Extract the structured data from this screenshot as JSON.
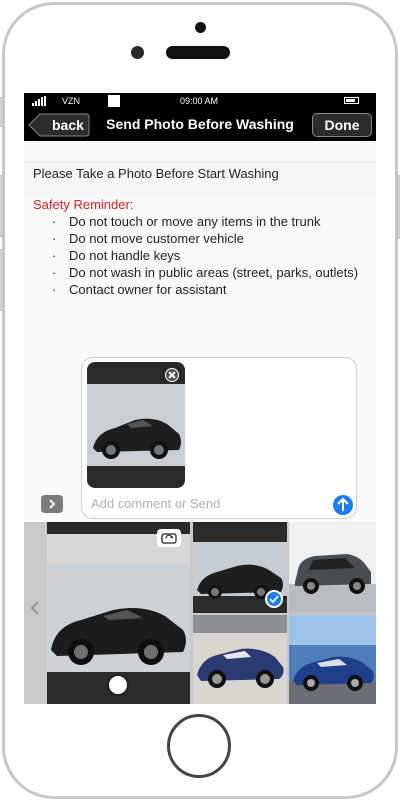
{
  "status_bar": {
    "carrier": "VZN",
    "time": "09:00 AM"
  },
  "nav": {
    "back_label": "back",
    "title": "Send Photo Before Washing",
    "done_label": "Done"
  },
  "instruction": "Please Take a Photo Before Start Washing",
  "safety": {
    "title": "Safety Reminder:",
    "bullet": "·",
    "items": [
      "Do not touch or move any items in the trunk",
      "Do not move customer vehicle",
      "Do not handle keys",
      "Do not wash in public areas (street, parks, outlets)",
      "Contact owner for assistant"
    ]
  },
  "composer": {
    "placeholder": "Add comment or Send"
  },
  "photo_tray": {
    "photos": [
      {
        "name": "black sports car",
        "selected": true
      },
      {
        "name": "grey suv",
        "selected": false
      },
      {
        "name": "blue convertible",
        "selected": false
      },
      {
        "name": "blue sports car",
        "selected": false
      }
    ]
  },
  "icons": {
    "back": "back-arrow-icon",
    "close": "close-icon",
    "expand": "chevron-right-icon",
    "send": "arrow-up-icon",
    "flip_camera": "camera-flip-icon",
    "shutter": "shutter-icon",
    "check": "checkmark-icon",
    "tray_prev": "chevron-left-icon"
  },
  "colors": {
    "accent": "#1a7df0",
    "warning": "#d02020",
    "bar": "#000000"
  }
}
